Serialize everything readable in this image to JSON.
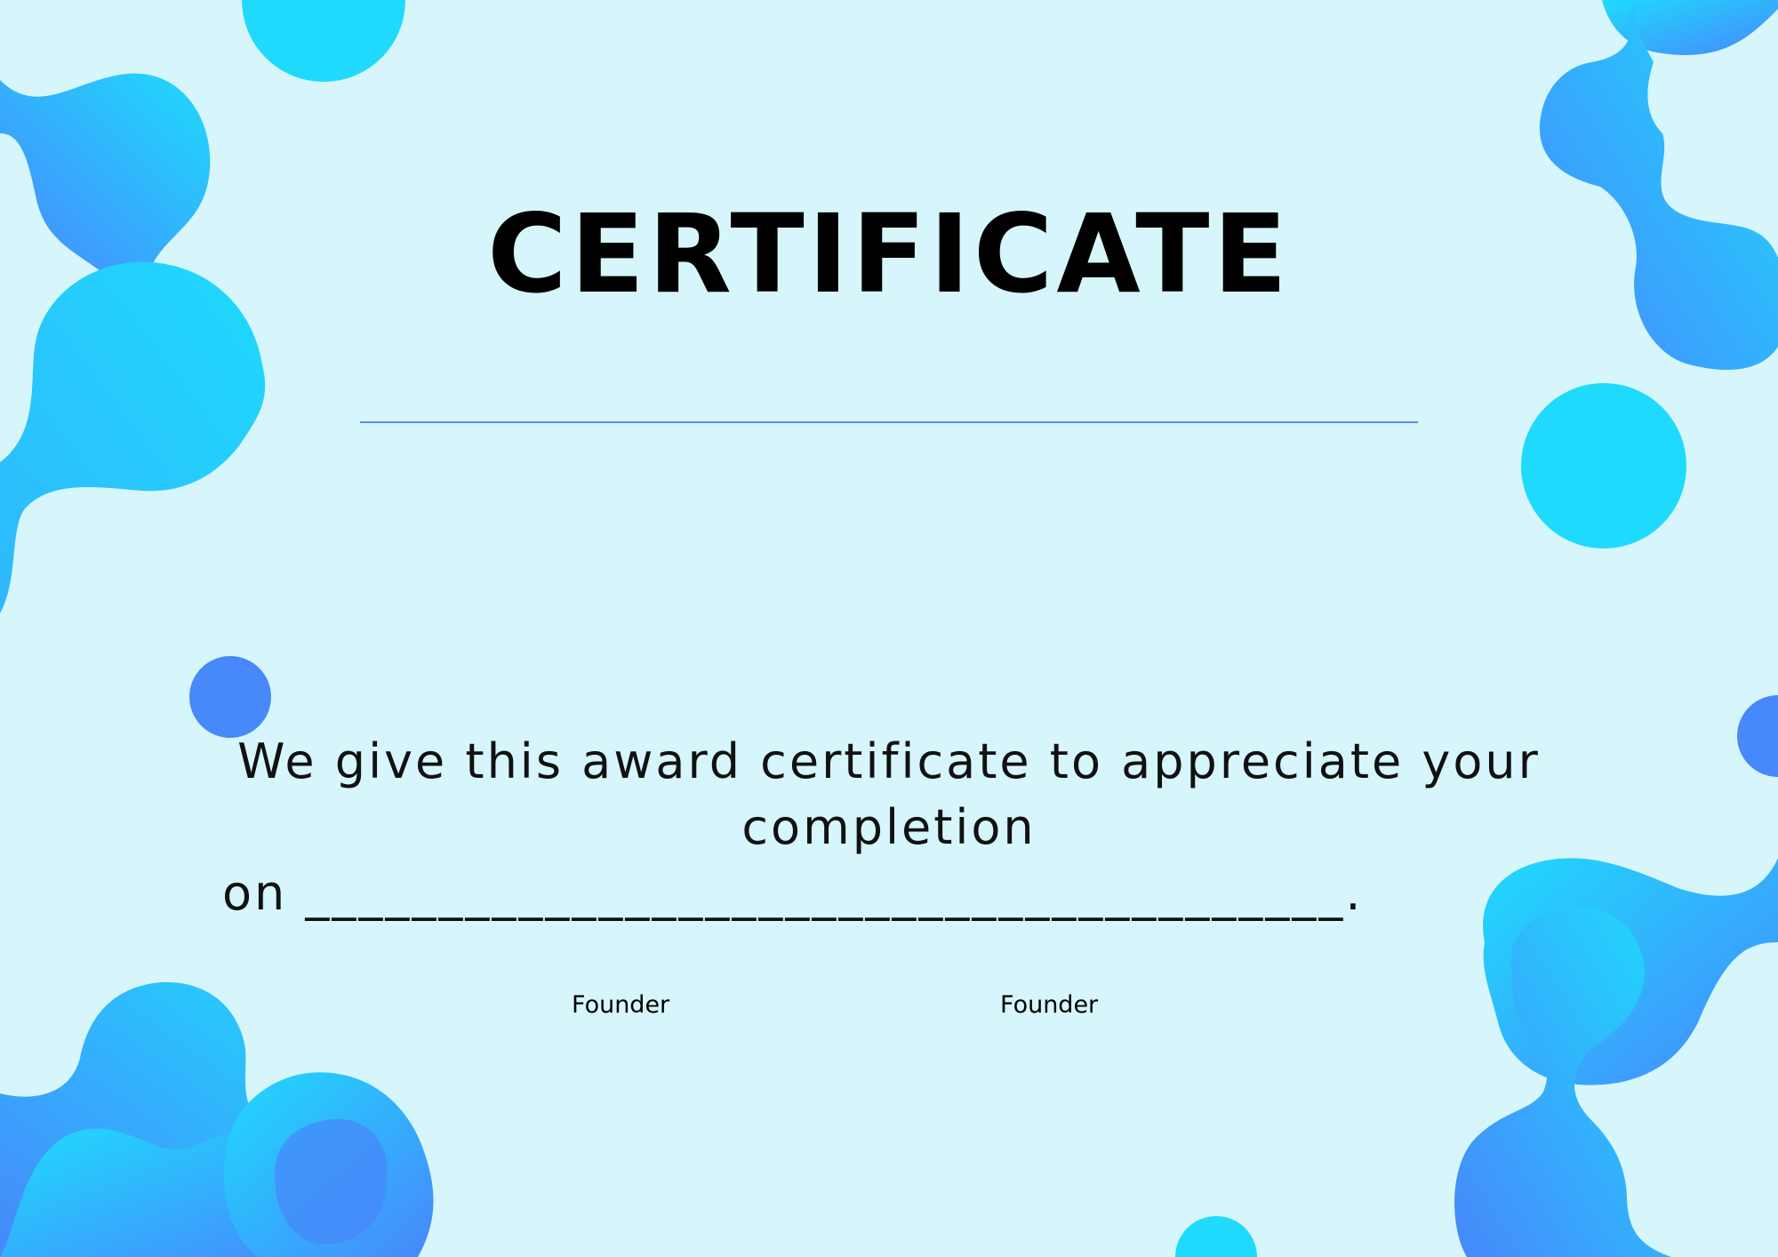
{
  "certificate": {
    "title": "CERTIFICATE",
    "body_line1": "We give this award certificate to appreciate your completion",
    "body_line2": "on  _______________________________________.",
    "signatures": [
      {
        "role": "Founder"
      },
      {
        "role": "Founder"
      }
    ]
  },
  "colors": {
    "background": "#d6f6fc",
    "cyan": "#1fdafd",
    "blue": "#4788fb",
    "rule": "#5a8ef5"
  }
}
